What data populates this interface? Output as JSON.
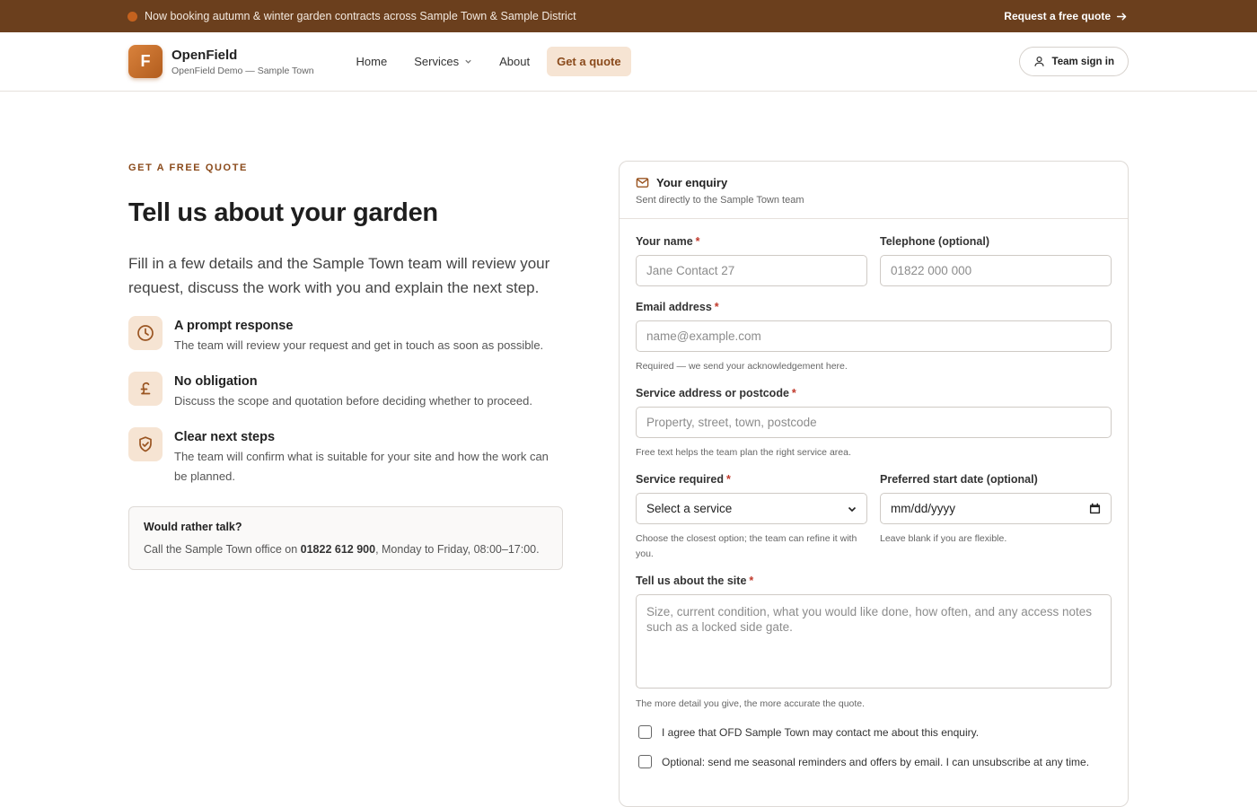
{
  "announce": {
    "text": "Now booking autumn & winter garden contracts across Sample Town & Sample District",
    "cta": "Request a free quote"
  },
  "brand": {
    "logo_letter": "F",
    "name": "OpenField",
    "sub": "OpenField Demo — Sample Town"
  },
  "nav": {
    "home": "Home",
    "services": "Services",
    "about": "About",
    "quote": "Get a quote"
  },
  "signin": "Team sign in",
  "hero": {
    "eyebrow": "GET A FREE QUOTE",
    "title": "Tell us about your garden",
    "intro": "Fill in a few details and the Sample Town team will review your request, discuss the work with you and explain the next step."
  },
  "features": [
    {
      "icon": "clock-icon",
      "title": "A prompt response",
      "desc": "The team will review your request and get in touch as soon as possible."
    },
    {
      "icon": "pound-icon",
      "title": "No obligation",
      "desc": "Discuss the scope and quotation before deciding whether to proceed."
    },
    {
      "icon": "shield-check-icon",
      "title": "Clear next steps",
      "desc": "The team will confirm what is suitable for your site and how the work can be planned."
    }
  ],
  "talk": {
    "title": "Would rather talk?",
    "pre": "Call the Sample Town office on ",
    "phone": "01822 612 900",
    "post": ", Monday to Friday, 08:00–17:00."
  },
  "form": {
    "title": "Your enquiry",
    "subtitle": "Sent directly to the Sample Town team",
    "name_label": "Your name",
    "name_placeholder": "Jane Contact 27",
    "tel_label": "Telephone (optional)",
    "tel_placeholder": "01822 000 000",
    "email_label": "Email address",
    "email_placeholder": "name@example.com",
    "email_hint": "Required — we send your acknowledgement here.",
    "address_label": "Service address or postcode",
    "address_placeholder": "Property, street, town, postcode",
    "address_hint": "Free text helps the team plan the right service area.",
    "service_label": "Service required",
    "service_value": "Select a service",
    "service_hint": "Choose the closest option; the team can refine it with you.",
    "date_label": "Preferred start date (optional)",
    "date_value": "mm/dd/yyyy",
    "date_hint": "Leave blank if you are flexible.",
    "site_label": "Tell us about the site",
    "site_placeholder": "Size, current condition, what you would like done, how often, and any access notes such as a locked side gate.",
    "site_hint": "The more detail you give, the more accurate the quote.",
    "consent": "I agree that OFD Sample Town may contact me about this enquiry.",
    "marketing": "Optional: send me seasonal reminders and offers by email. I can unsubscribe at any time.",
    "required_mark": "*"
  },
  "colors": {
    "brand_brown": "#6b3f1d",
    "accent": "#8a4a1b",
    "accent_bg": "#f6e4d3",
    "required": "#c0392b"
  }
}
